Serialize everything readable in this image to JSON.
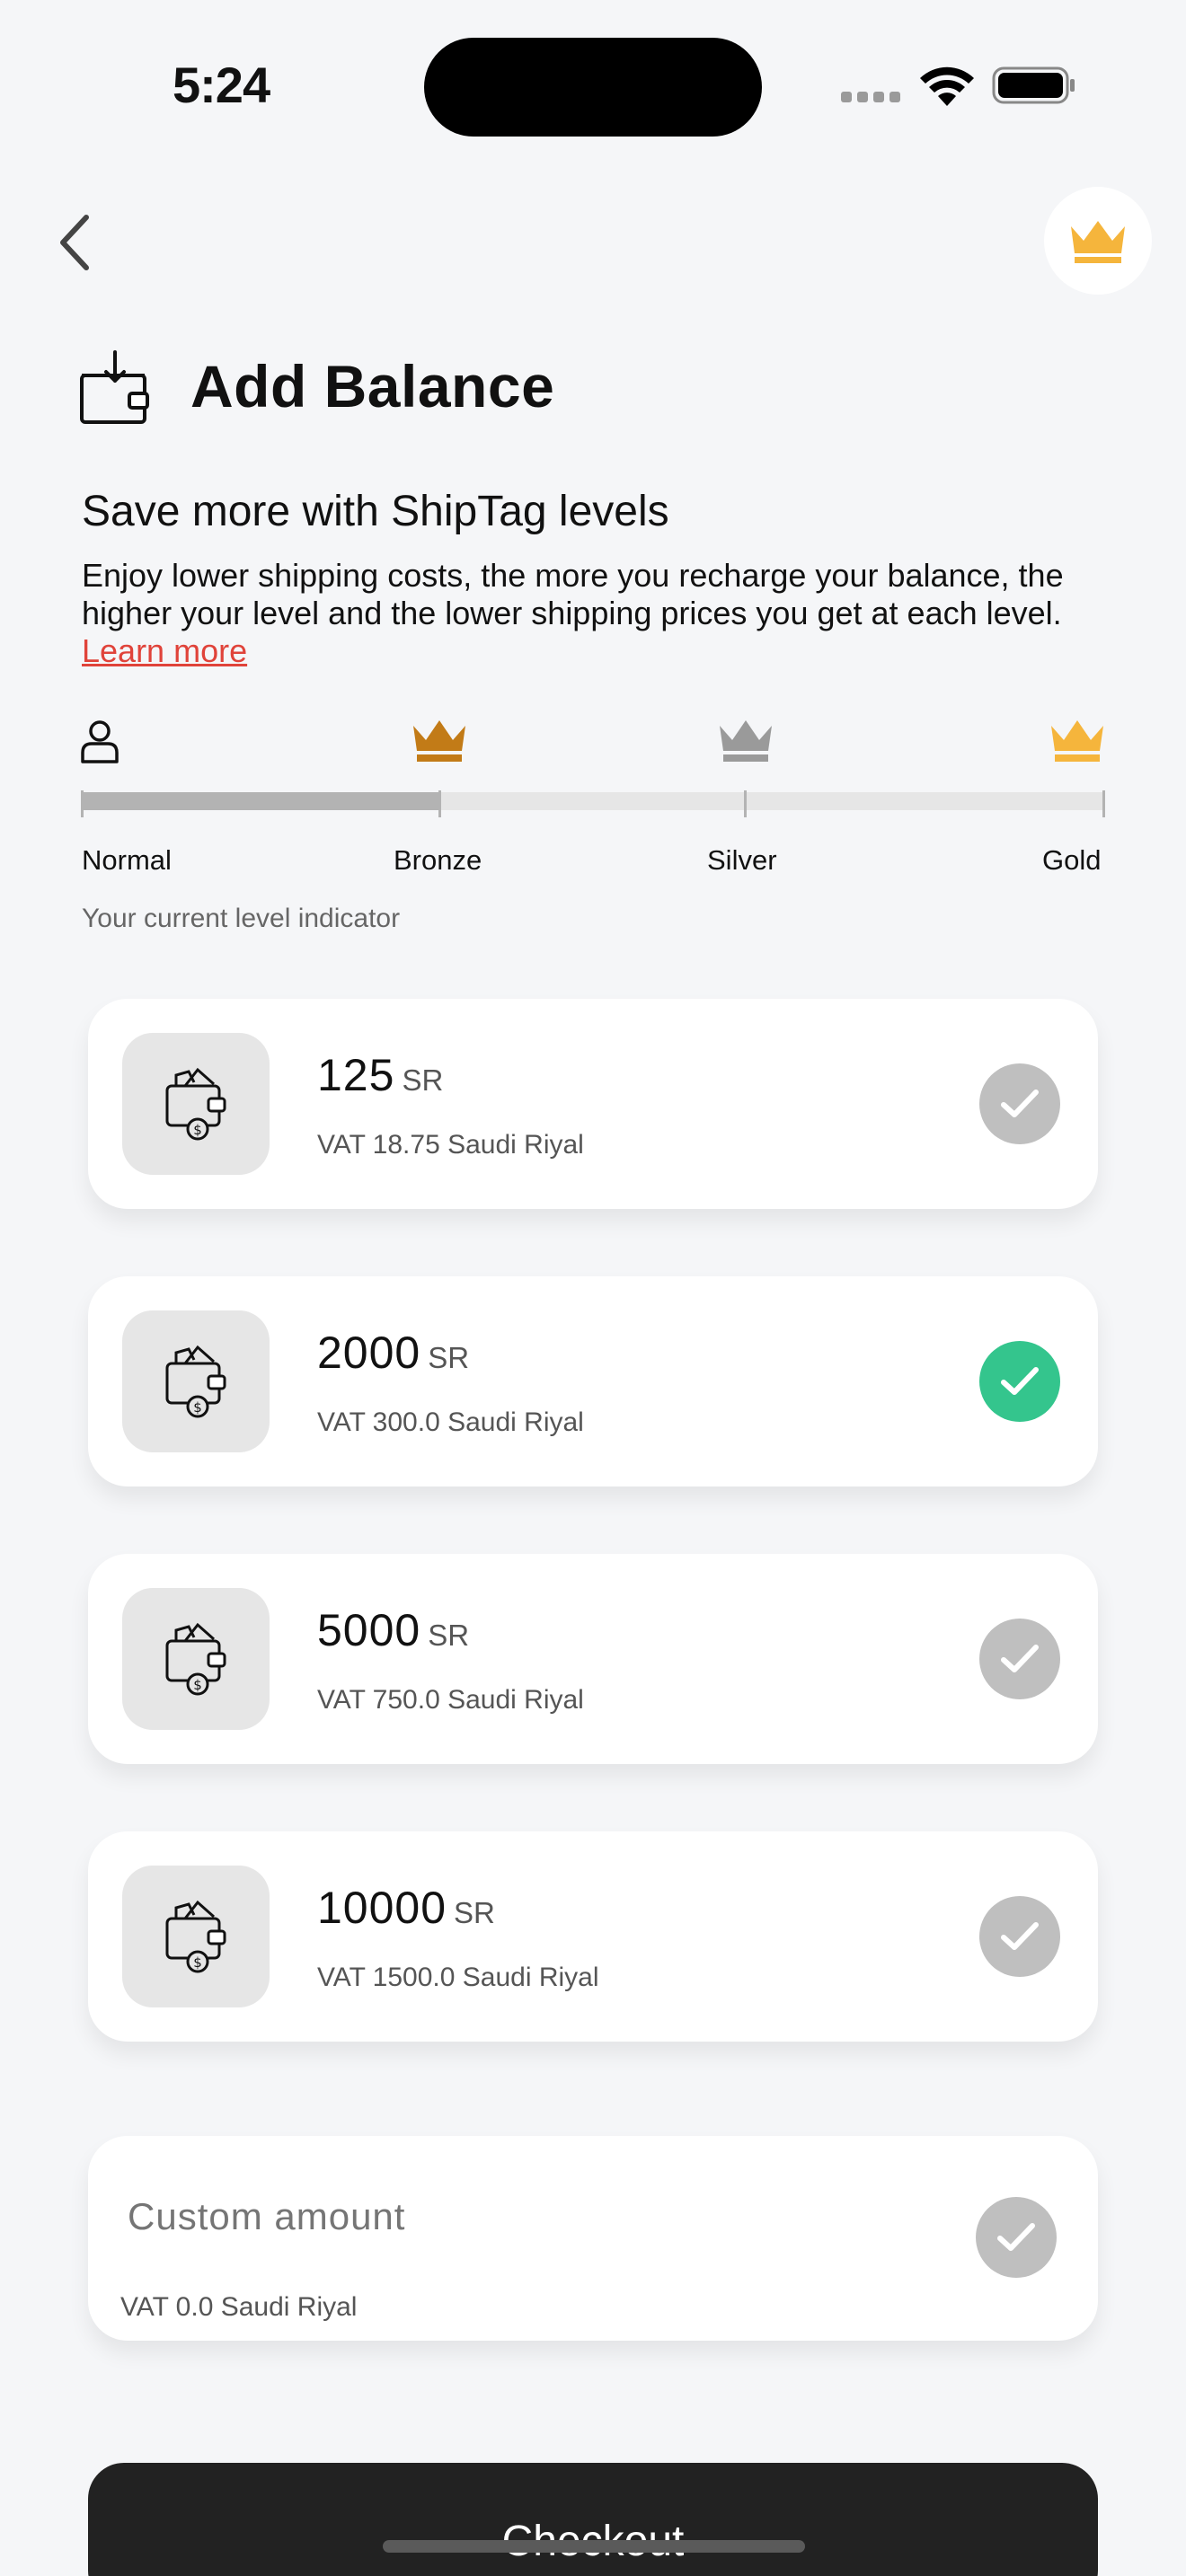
{
  "status_bar": {
    "time": "5:24"
  },
  "header": {
    "back_icon": "chevron-left-icon",
    "membership_icon": "crown-icon",
    "title_icon": "wallet-download-icon",
    "title": "Add Balance"
  },
  "intro": {
    "subtitle": "Save more with ShipTag levels",
    "description": "Enjoy lower shipping costs, the more you recharge your balance, the higher your level and the lower shipping prices you get at each level.",
    "learn_more": "Learn more"
  },
  "levels": {
    "items": [
      {
        "label": "Normal",
        "icon": "user-icon"
      },
      {
        "label": "Bronze",
        "icon": "crown-icon",
        "color": "#c27b17"
      },
      {
        "label": "Silver",
        "icon": "crown-icon",
        "color": "#9a9a9a"
      },
      {
        "label": "Gold",
        "icon": "crown-icon",
        "color": "#f5b53c"
      }
    ],
    "progress_fraction": 0.35,
    "caption": "Your current level indicator"
  },
  "amounts": [
    {
      "value": "125",
      "unit": "SR",
      "vat": "VAT 18.75 Saudi Riyal",
      "selected": false
    },
    {
      "value": "2000",
      "unit": "SR",
      "vat": "VAT 300.0 Saudi Riyal",
      "selected": true
    },
    {
      "value": "5000",
      "unit": "SR",
      "vat": "VAT 750.0 Saudi Riyal",
      "selected": false
    },
    {
      "value": "10000",
      "unit": "SR",
      "vat": "VAT 1500.0 Saudi Riyal",
      "selected": false
    }
  ],
  "custom": {
    "placeholder": "Custom amount",
    "value": "",
    "vat": "VAT 0.0 Saudi Riyal"
  },
  "checkout": {
    "label": "Checkout"
  },
  "colors": {
    "selected": "#34c58d",
    "unselected": "#bfbfbf",
    "link": "#e0433a",
    "button": "#222222",
    "gold": "#f5b53c",
    "bronze": "#c27b17",
    "silver": "#9a9a9a"
  }
}
